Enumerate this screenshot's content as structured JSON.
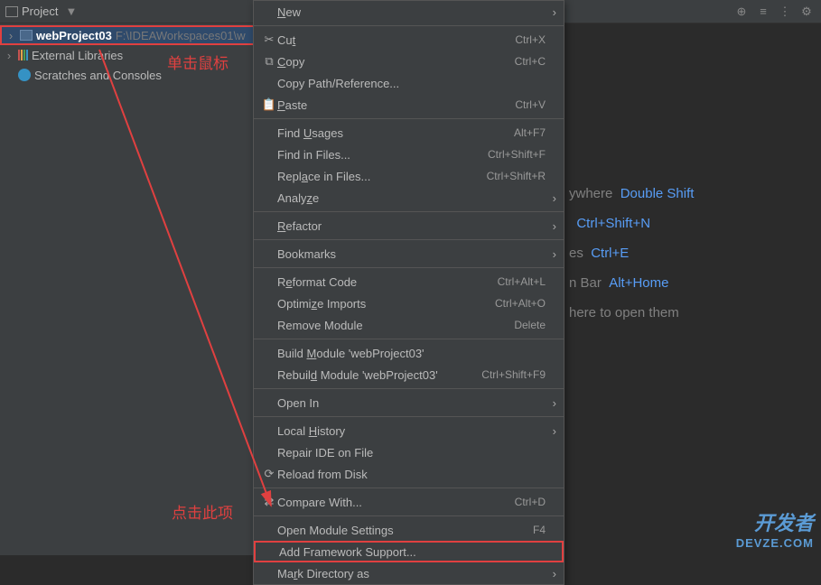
{
  "toolbar": {
    "title": "Project"
  },
  "tree": {
    "project_name": "webProject03",
    "project_path": "F:\\IDEAWorkspaces01\\w",
    "external_libs": "External Libraries",
    "scratches": "Scratches and Consoles"
  },
  "annotations": {
    "click_mouse": "单击鼠标",
    "click_item": "点击此项"
  },
  "menu": {
    "new": "New",
    "cut": "Cut",
    "cut_key": "Ctrl+X",
    "copy": "Copy",
    "copy_key": "Ctrl+C",
    "copy_path": "Copy Path/Reference...",
    "paste": "Paste",
    "paste_key": "Ctrl+V",
    "find_usages": "Find Usages",
    "find_usages_key": "Alt+F7",
    "find_in_files": "Find in Files...",
    "find_in_files_key": "Ctrl+Shift+F",
    "replace_in_files": "Replace in Files...",
    "replace_in_files_key": "Ctrl+Shift+R",
    "analyze": "Analyze",
    "refactor": "Refactor",
    "bookmarks": "Bookmarks",
    "reformat": "Reformat Code",
    "reformat_key": "Ctrl+Alt+L",
    "optimize": "Optimize Imports",
    "optimize_key": "Ctrl+Alt+O",
    "remove_module": "Remove Module",
    "remove_module_key": "Delete",
    "build_module": "Build Module 'webProject03'",
    "rebuild_module": "Rebuild Module 'webProject03'",
    "rebuild_key": "Ctrl+Shift+F9",
    "open_in": "Open In",
    "local_history": "Local History",
    "repair_ide": "Repair IDE on File",
    "reload_disk": "Reload from Disk",
    "compare_with": "Compare With...",
    "compare_key": "Ctrl+D",
    "open_module_settings": "Open Module Settings",
    "open_module_key": "F4",
    "add_framework": "Add Framework Support...",
    "mark_dir": "Mark Directory as"
  },
  "hints": {
    "everywhere": "ywhere",
    "everywhere_key": "Double Shift",
    "goto_file_key": "Ctrl+Shift+N",
    "recent": "es",
    "recent_key": "Ctrl+E",
    "nav_bar": "n Bar",
    "nav_bar_key": "Alt+Home",
    "drop": "here to open them"
  },
  "watermark": {
    "main": "开发者",
    "sub": "DEVZE.COM"
  }
}
